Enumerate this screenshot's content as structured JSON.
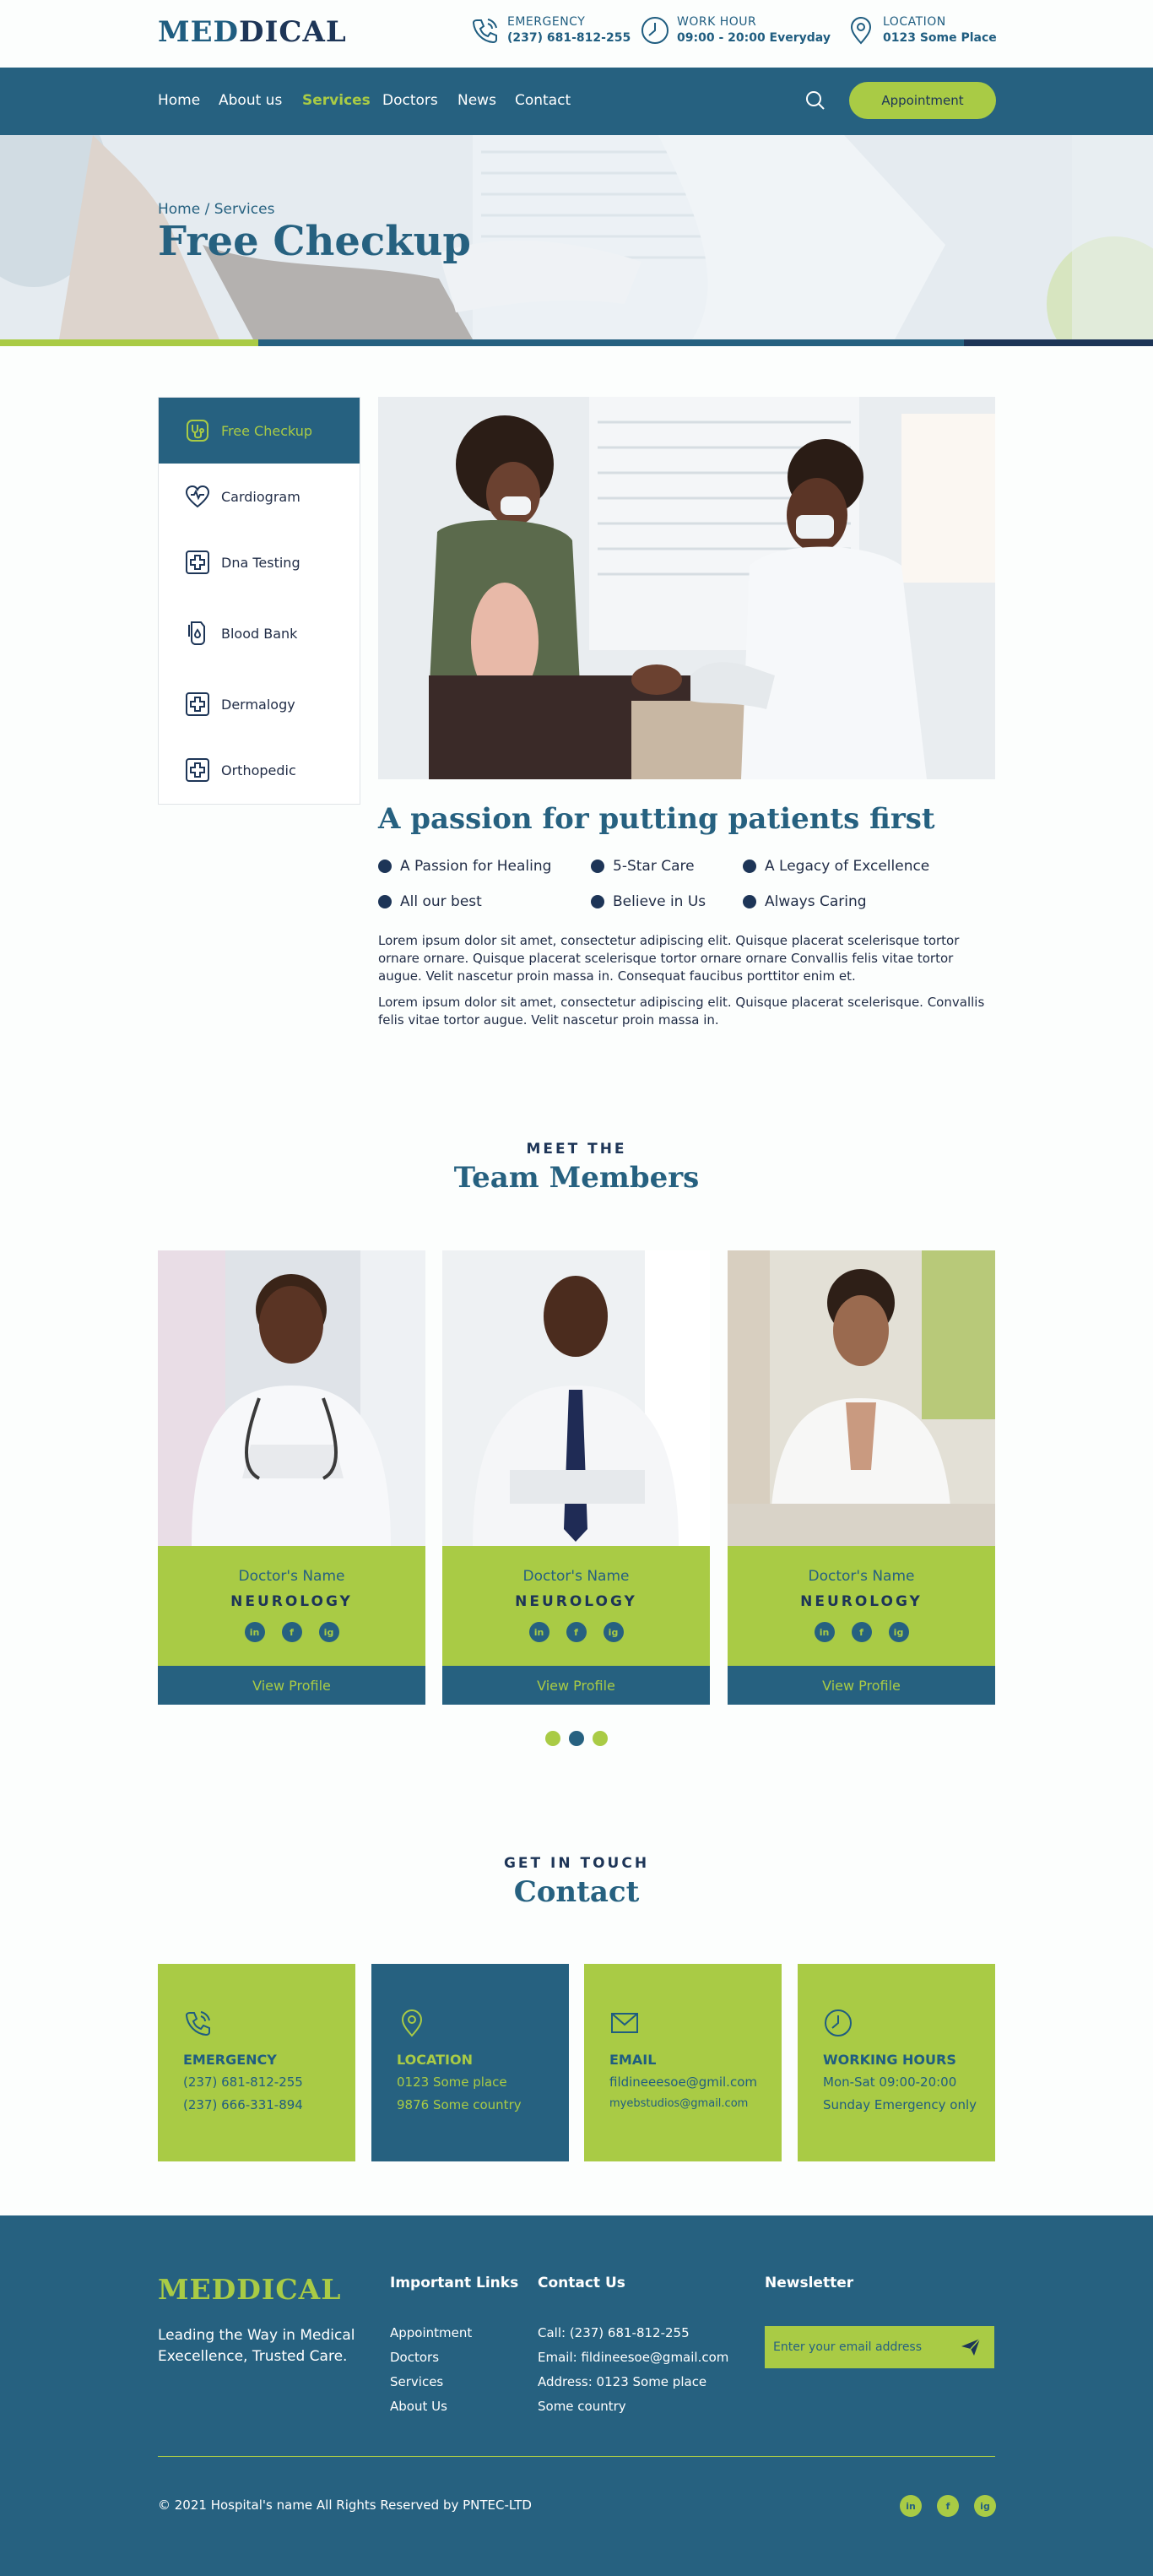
{
  "brand": {
    "part1": "MED",
    "part2": "DICAL",
    "colors": {
      "primary": "#266180",
      "accent": "#a9cb45",
      "dark": "#1d3557"
    }
  },
  "header_info": [
    {
      "label": "EMERGENCY",
      "value": "(237) 681-812-255",
      "icon": "phone-icon"
    },
    {
      "label": "WORK HOUR",
      "value": "09:00 - 20:00 Everyday",
      "icon": "clock-icon"
    },
    {
      "label": "LOCATION",
      "value": "0123 Some Place",
      "icon": "location-pin-icon"
    }
  ],
  "nav": {
    "items": [
      "Home",
      "About us",
      "Services",
      "Doctors",
      "News",
      "Contact"
    ],
    "active": "Services",
    "appointment_label": "Appointment"
  },
  "hero": {
    "breadcrumb": "Home / Services",
    "title": "Free Checkup"
  },
  "sidebar": {
    "items": [
      "Free Checkup",
      "Cardiogram",
      "Dna Testing",
      "Blood Bank",
      "Dermalogy",
      "Orthopedic"
    ],
    "active": "Free Checkup"
  },
  "content": {
    "title": "A passion for putting patients first",
    "bullets": [
      "A Passion for Healing",
      "5-Star Care",
      "A Legacy of Excellence",
      "All our best",
      "Believe in Us",
      "Always Caring"
    ],
    "para1": "Lorem ipsum dolor sit amet, consectetur adipiscing elit. Quisque placerat scelerisque tortor ornare ornare. Quisque placerat scelerisque tortor ornare ornare Convallis felis vitae tortor augue. Velit nascetur proin massa in. Consequat faucibus porttitor enim et.",
    "para2": "Lorem ipsum dolor sit amet, consectetur adipiscing elit. Quisque placerat scelerisque. Convallis felis vitae tortor augue. Velit nascetur proin massa in."
  },
  "team": {
    "kicker": "MEET THE",
    "title": "Team Members",
    "cards": [
      {
        "name": "Doctor's Name",
        "dept": "NEUROLOGY",
        "view": "View Profile"
      },
      {
        "name": "Doctor's Name",
        "dept": "NEUROLOGY",
        "view": "View Profile"
      },
      {
        "name": "Doctor's Name",
        "dept": "NEUROLOGY",
        "view": "View Profile"
      }
    ],
    "social_labels": [
      "in",
      "f",
      "ig"
    ]
  },
  "contact": {
    "kicker": "GET IN TOUCH",
    "title": "Contact",
    "cards": [
      {
        "title": "EMERGENCY",
        "line1": "(237) 681-812-255",
        "line2": "(237) 666-331-894",
        "icon": "phone-icon"
      },
      {
        "title": "LOCATION",
        "line1": "0123 Some place",
        "line2": "9876 Some country",
        "icon": "location-pin-icon"
      },
      {
        "title": "EMAIL",
        "line1": "fildineeesoe@gmil.com",
        "line2": "myebstudios@gmail.com",
        "icon": "mail-icon"
      },
      {
        "title": "WORKING HOURS",
        "line1": "Mon-Sat 09:00-20:00",
        "line2": "Sunday Emergency only",
        "icon": "clock-icon"
      }
    ]
  },
  "footer": {
    "logo": "MEDDICAL",
    "tagline": "Leading the Way in Medical Execellence, Trusted Care.",
    "links_title": "Important Links",
    "links": [
      "Appointment",
      "Doctors",
      "Services",
      "About Us"
    ],
    "contact_title": "Contact Us",
    "contact_lines": [
      "Call: (237) 681-812-255",
      "Email: fildineesoe@gmail.com",
      "Address: 0123 Some place",
      "Some country"
    ],
    "newsletter_title": "Newsletter",
    "newsletter_placeholder": "Enter your email address",
    "copyright": "© 2021 Hospital's name All Rights Reserved by PNTEC-LTD"
  }
}
